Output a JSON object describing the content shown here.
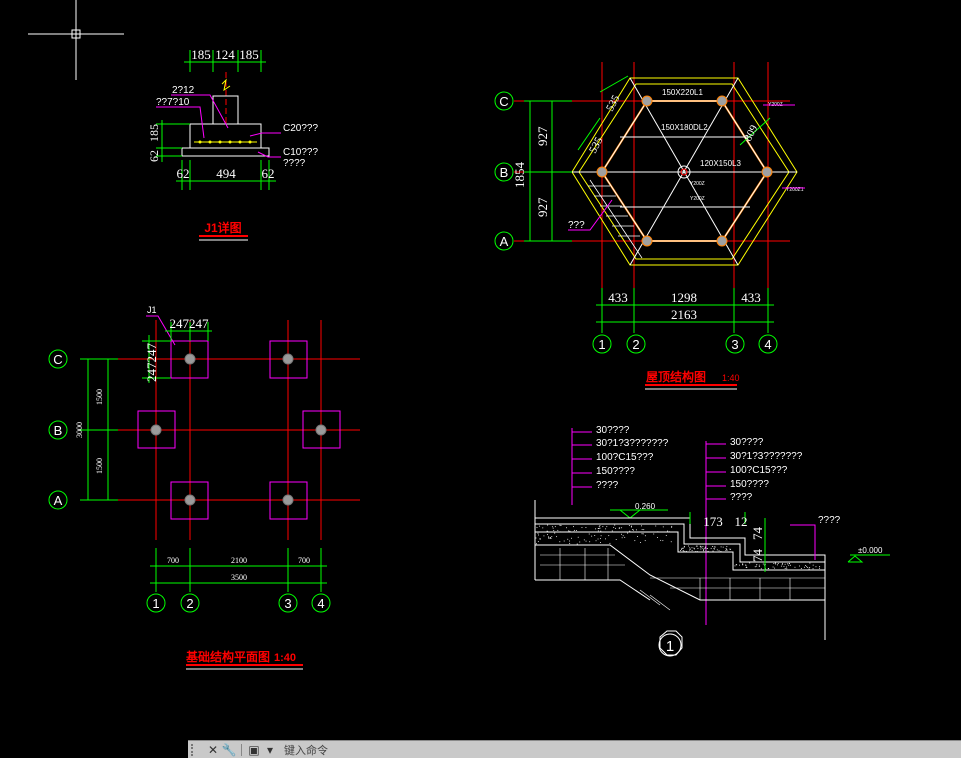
{
  "cursor": {},
  "detail_j1": {
    "title": "J1详图",
    "top_dims": [
      "185",
      "124",
      "185"
    ],
    "bottom_dims": [
      "62",
      "494",
      "62"
    ],
    "left_dims": [
      "62",
      "185"
    ],
    "labels": [
      "2?12",
      "??7?10",
      "C20???",
      "C10???",
      "????"
    ]
  },
  "roof_plan": {
    "title": "屋顶结构图",
    "scale": "1:40",
    "axes_rows": [
      "C",
      "B",
      "A"
    ],
    "axes_cols": [
      "1",
      "2",
      "3",
      "4"
    ],
    "left_dims": [
      "927",
      "927",
      "1854"
    ],
    "bottom_dims": [
      "433",
      "1298",
      "433"
    ],
    "bottom_total": "2163",
    "beam_labels": [
      "150X220L1",
      "150X180DL2",
      "120X150L3"
    ],
    "side_dims": [
      "535",
      "535",
      "809"
    ],
    "tag_labels": [
      "???",
      "Y200Z",
      "Y200Z1",
      "Y200Z",
      "Y200Z"
    ]
  },
  "foundation_plan": {
    "title": "基础结构平面图",
    "scale": "1:40",
    "axes_rows": [
      "C",
      "B",
      "A"
    ],
    "axes_cols": [
      "1",
      "2",
      "3",
      "4"
    ],
    "tag": "J1",
    "top_dims": "247247",
    "left_dims_rot": "247247",
    "left_dims": [
      "1500",
      "3000",
      "1500"
    ],
    "bottom_dims": [
      "700",
      "2100",
      "700"
    ],
    "bottom_total": "3500"
  },
  "section": {
    "marker": "1",
    "layers_left": [
      "30????",
      "30?1?3???????",
      "100?C15???",
      "150????",
      "????"
    ],
    "layers_right": [
      "30????",
      "30?1?3???????",
      "100?C15???",
      "150????",
      "????"
    ],
    "elev_top": "0.260",
    "dims": [
      "173",
      "12",
      "74",
      "74"
    ],
    "label_right": "????",
    "elev_zero": "±0.000"
  },
  "command_bar": {
    "prompt": "键入命令"
  },
  "colors": {
    "bg": "#000000",
    "axis_red": "#ff0000",
    "dim_green": "#00ff00",
    "magenta": "#ff00ff",
    "yellow": "#ffff00",
    "white": "#ffffff",
    "orange": "#ff8000"
  }
}
